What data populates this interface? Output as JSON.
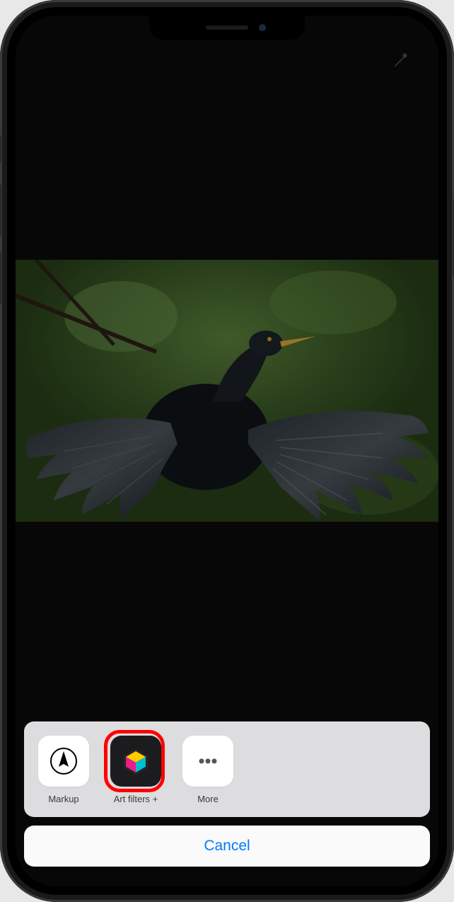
{
  "actionSheet": {
    "apps": [
      {
        "label": "Markup"
      },
      {
        "label": "Art filters +"
      },
      {
        "label": "More"
      }
    ],
    "cancel_label": "Cancel"
  }
}
